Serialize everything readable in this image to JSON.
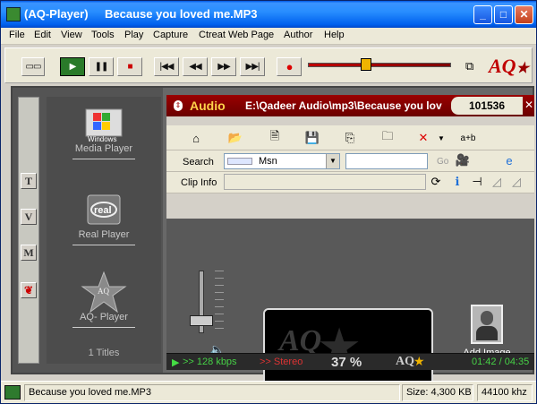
{
  "window": {
    "app": "(AQ-Player)",
    "title": "Because you loved me.MP3"
  },
  "menu": [
    "File",
    "Edit",
    "View",
    "Tools",
    "Play",
    "Capture",
    "Ctreat Web Page",
    "Author",
    "Help"
  ],
  "transport": {
    "buttons": [
      "play",
      "pause",
      "stop",
      "first",
      "rewind",
      "forward",
      "last",
      "record"
    ],
    "volume_fraction": 0.39
  },
  "logo": "AQ",
  "sidebar": {
    "tabs": [
      "T",
      "V",
      "M"
    ],
    "players": [
      {
        "label": "Media Player",
        "icon": "windows-media-icon"
      },
      {
        "label": "Real Player",
        "icon": "real-player-icon"
      },
      {
        "label": "AQ- Player",
        "icon": "aq-star-icon"
      }
    ],
    "titles_count": "1  Titles"
  },
  "audio": {
    "label": "Audio",
    "path": "E:\\Qadeer Audio\\mp3\\Because you lov",
    "counter": "101536"
  },
  "search": {
    "label": "Search",
    "engine": "Msn",
    "query": "",
    "go": "Go"
  },
  "clip": {
    "label": "Clip Info",
    "value": ""
  },
  "viewer": {
    "add_image_label": "Add Image",
    "screen_logo": "AQ"
  },
  "status": {
    "bitrate": ">> 128 kbps",
    "channels": ">> Stereo",
    "percent": "37 %",
    "time": "01:42 / 04:35"
  },
  "statusbar": {
    "track": "Because you loved me.MP3",
    "size": "Size: 4,300 KB",
    "rate": "44100 khz"
  }
}
